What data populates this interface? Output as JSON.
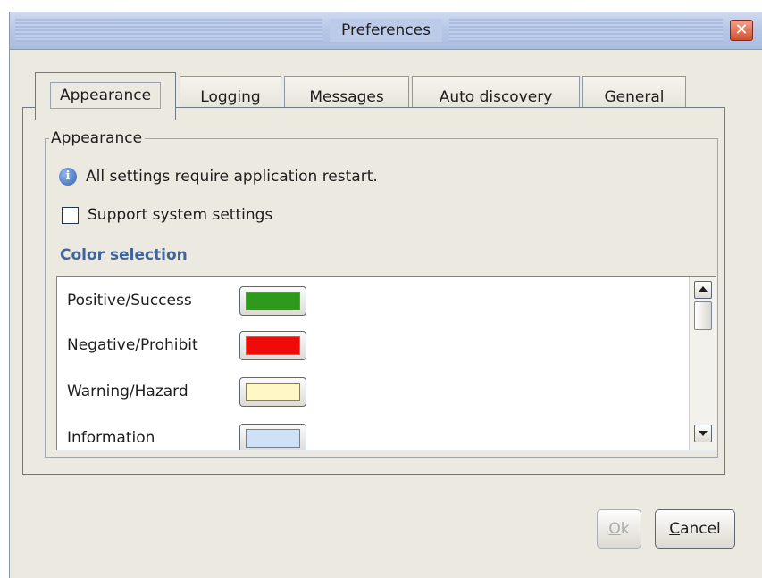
{
  "window": {
    "title": "Preferences",
    "close_glyph": "✕"
  },
  "tabs": [
    {
      "label": "Appearance",
      "active": true
    },
    {
      "label": "Logging",
      "active": false
    },
    {
      "label": "Messages",
      "active": false
    },
    {
      "label": "Auto discovery",
      "active": false
    },
    {
      "label": "General",
      "active": false
    }
  ],
  "appearance": {
    "group_title": "Appearance",
    "info_icon": "info-icon",
    "info_glyph": "i",
    "info_text": "All settings require application restart.",
    "support_system_settings": {
      "label": "Support system settings",
      "checked": false
    },
    "color_section_title": "Color selection",
    "colors": [
      {
        "label": "Positive/Success",
        "color": "#2e9a1c"
      },
      {
        "label": "Negative/Prohibit",
        "color": "#f00a0a"
      },
      {
        "label": "Warning/Hazard",
        "color": "#fff8c6"
      },
      {
        "label": "Information",
        "color": "#cfe1f6"
      }
    ]
  },
  "buttons": {
    "ok": {
      "mnemonic": "O",
      "rest": "k",
      "enabled": false
    },
    "cancel": {
      "mnemonic": "C",
      "rest": "ancel",
      "enabled": true
    }
  },
  "theme": {
    "title_bar": "#b6c7e6",
    "window_bg": "#ece9e1",
    "section_title_color": "#41649a"
  }
}
